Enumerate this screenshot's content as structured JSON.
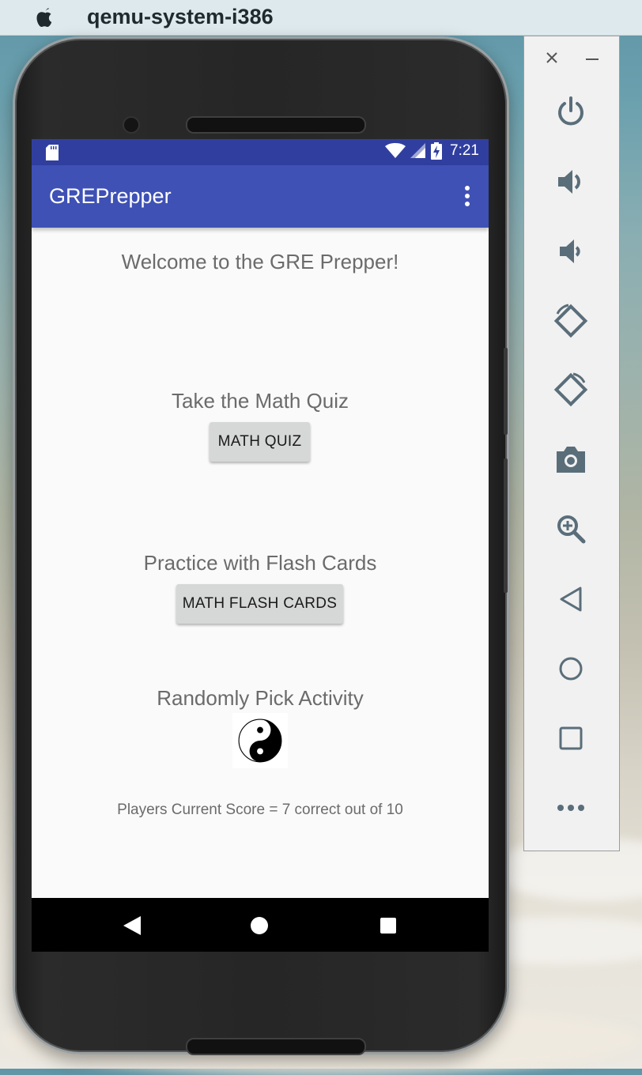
{
  "menubar": {
    "app_name": "qemu-system-i386"
  },
  "statusbar": {
    "time": "7:21"
  },
  "app": {
    "title": "GREPrepper",
    "welcome": "Welcome to the GRE Prepper!",
    "quiz_heading": "Take the Math Quiz",
    "quiz_button": "MATH QUIZ",
    "flash_heading": "Practice with Flash Cards",
    "flash_button": "MATH FLASH CARDS",
    "random_heading": "Randomly Pick Activity",
    "random_icon": "yin-yang-icon",
    "score_text": "Players Current Score = 7 correct out of 10"
  },
  "navbar": {
    "icons": [
      "back-icon",
      "home-icon",
      "recents-icon"
    ]
  },
  "emulator_panel": {
    "tools": [
      "power-icon",
      "volume-up-icon",
      "volume-down-icon",
      "rotate-left-icon",
      "rotate-right-icon",
      "camera-icon",
      "zoom-icon",
      "back-icon",
      "home-icon",
      "overview-icon",
      "more-icon"
    ]
  },
  "colors": {
    "primary": "#3f51b5",
    "primary_dark": "#303f9f",
    "button": "#d6d7d7",
    "text_secondary": "#6b6b6b",
    "panel_icon": "#5a6e7a"
  }
}
